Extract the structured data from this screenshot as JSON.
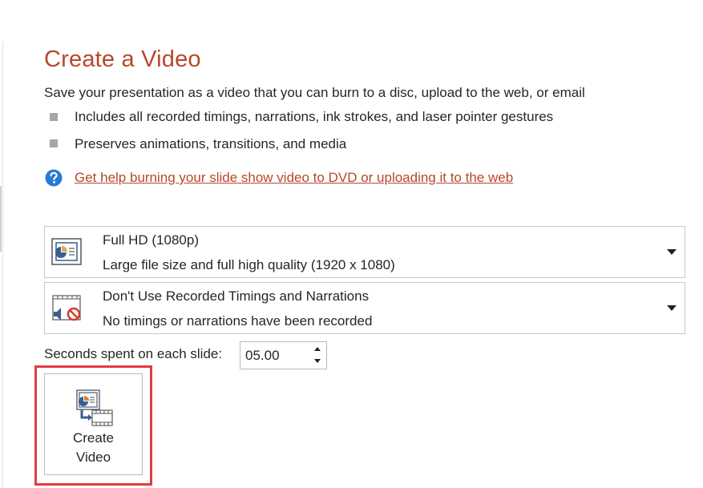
{
  "page": {
    "title": "Create a Video",
    "subtitle": "Save your presentation as a video that you can burn to a disc, upload to the web, or email",
    "bullets": [
      "Includes all recorded timings, narrations, ink strokes, and laser pointer gestures",
      "Preserves animations, transitions, and media"
    ],
    "help_link": "Get help burning your slide show video to DVD or uploading it to the web"
  },
  "quality_dropdown": {
    "title": "Full HD (1080p)",
    "description": "Large file size and full high quality (1920 x 1080)",
    "icon": "presentation-quality-icon"
  },
  "timings_dropdown": {
    "title": "Don't Use Recorded Timings and Narrations",
    "description": "No timings or narrations have been recorded",
    "icon": "no-narration-icon"
  },
  "seconds": {
    "label": "Seconds spent on each slide:",
    "value": "05.00"
  },
  "create_button": {
    "line1": "Create",
    "line2": "Video",
    "icon": "create-video-icon"
  },
  "colors": {
    "accent": "#b7472a",
    "help_icon": "#2b79d6",
    "highlight": "#e03c40"
  }
}
